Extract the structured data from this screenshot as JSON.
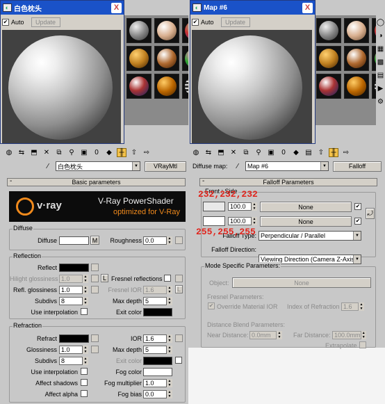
{
  "left_window": {
    "title": "白色枕头",
    "close": "X",
    "auto_label": "Auto",
    "update_label": "Update"
  },
  "right_window": {
    "title": "Map #6",
    "close": "X",
    "auto_label": "Auto",
    "update_label": "Update"
  },
  "left_editor": {
    "material_name": "白色枕头",
    "material_type": "VRayMtl",
    "basic_rollout": "Basic parameters",
    "banner": {
      "logo": "v·ray",
      "line1": "V-Ray PowerShader",
      "line2": "optimized for V-Ray"
    },
    "diffuse": {
      "group": "Diffuse",
      "label": "Diffuse",
      "map_btn": "M",
      "roughness_label": "Roughness",
      "roughness": "0.0"
    },
    "reflection": {
      "group": "Reflection",
      "reflect": "Reflect",
      "hilight_label": "Hilight glossiness",
      "hilight": "1.0",
      "lock": "L",
      "fresnel_label": "Fresnel reflections",
      "refl_gloss_label": "Refl. glossiness",
      "refl_gloss": "1.0",
      "fresnel_ior_label": "Fresnel IOR",
      "fresnel_ior": "1.6",
      "lock2": "L",
      "subdivs_label": "Subdivs",
      "subdivs": "8",
      "max_depth_label": "Max depth",
      "max_depth": "5",
      "interp_label": "Use interpolation",
      "exit_label": "Exit color"
    },
    "refraction": {
      "group": "Refraction",
      "refract": "Refract",
      "ior_label": "IOR",
      "ior": "1.6",
      "gloss_label": "Glossiness",
      "gloss": "1.0",
      "max_depth_label": "Max depth",
      "max_depth": "5",
      "subdivs_label": "Subdivs",
      "subdivs": "8",
      "exit_label": "Exit color",
      "interp_label": "Use interpolation",
      "fog_color_label": "Fog color",
      "shadows_label": "Affect shadows",
      "fog_mult_label": "Fog multiplier",
      "fog_mult": "1.0",
      "alpha_label": "Affect alpha",
      "fog_bias_label": "Fog bias",
      "fog_bias": "0.0"
    }
  },
  "right_editor": {
    "diffuse_map_label": "Diffuse map:",
    "map_name": "Map #6",
    "map_type": "Falloff",
    "rollout": "Falloff Parameters",
    "front_side": "Front : Side",
    "row1": {
      "value": "100.0",
      "map": "None"
    },
    "row2": {
      "value": "100.0",
      "map": "None"
    },
    "falloff_type_label": "Falloff Type:",
    "falloff_type": "Perpendicular / Parallel",
    "falloff_dir_label": "Falloff Direction:",
    "falloff_dir": "Viewing Direction (Camera Z-Axis)",
    "mode_group": "Mode Specific Parameters:",
    "object_label": "Object:",
    "object_value": "None",
    "fresnel_params": "Fresnel Parameters:",
    "override_ior": "Override Material IOR",
    "ior_label": "Index of Refraction",
    "ior": "1.6",
    "dist_params": "Distance Blend Parameters:",
    "near_label": "Near Distance:",
    "near": "0.0mm",
    "far_label": "Far Distance:",
    "far": "100.0mm",
    "extrapolate": "Extrapolate"
  },
  "annotations": {
    "top": "232,232,232",
    "bottom": "255,255,255"
  },
  "colors": {
    "front_swatch": "#e8e8e8",
    "side_swatch": "#ffffff",
    "annotation": "#e0241c"
  }
}
